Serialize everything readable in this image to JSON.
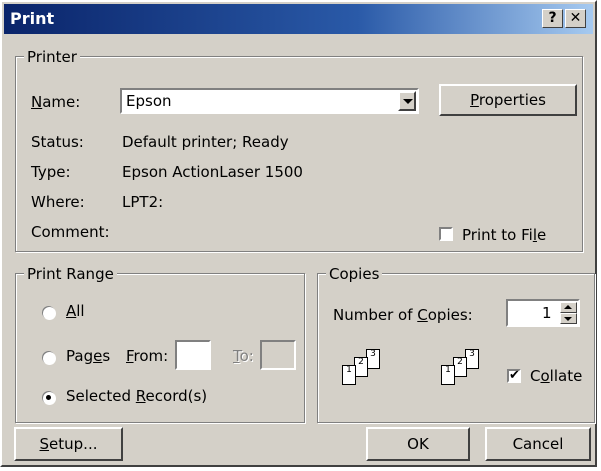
{
  "titlebar": {
    "title": "Print",
    "help_label": "?",
    "close_label": "✕"
  },
  "printer": {
    "legend": "Printer",
    "name_label": "Name:",
    "name_value": "Epson",
    "properties_label": "Properties",
    "status_label": "Status:",
    "status_value": "Default printer; Ready",
    "type_label": "Type:",
    "type_value": "Epson ActionLaser 1500",
    "where_label": "Where:",
    "where_value": "LPT2:",
    "comment_label": "Comment:",
    "print_to_file_label": "Print to File",
    "print_to_file_checked": false
  },
  "print_range": {
    "legend": "Print Range",
    "all_label": "All",
    "pages_label": "Pages",
    "from_label": "From:",
    "to_label": "To:",
    "selected_label": "Selected Record(s)",
    "selected_option": "Selected Record(s)"
  },
  "copies": {
    "legend": "Copies",
    "number_label": "Number of Copies:",
    "number_value": "1",
    "collate_label": "Collate",
    "collate_checked": true,
    "page_numbers": [
      "1",
      "2",
      "3"
    ]
  },
  "buttons": {
    "setup": "Setup...",
    "ok": "OK",
    "cancel": "Cancel"
  },
  "colors": {
    "titlebar_start": "#0a246a",
    "titlebar_end": "#a6caf0",
    "face": "#d4d0c8"
  }
}
